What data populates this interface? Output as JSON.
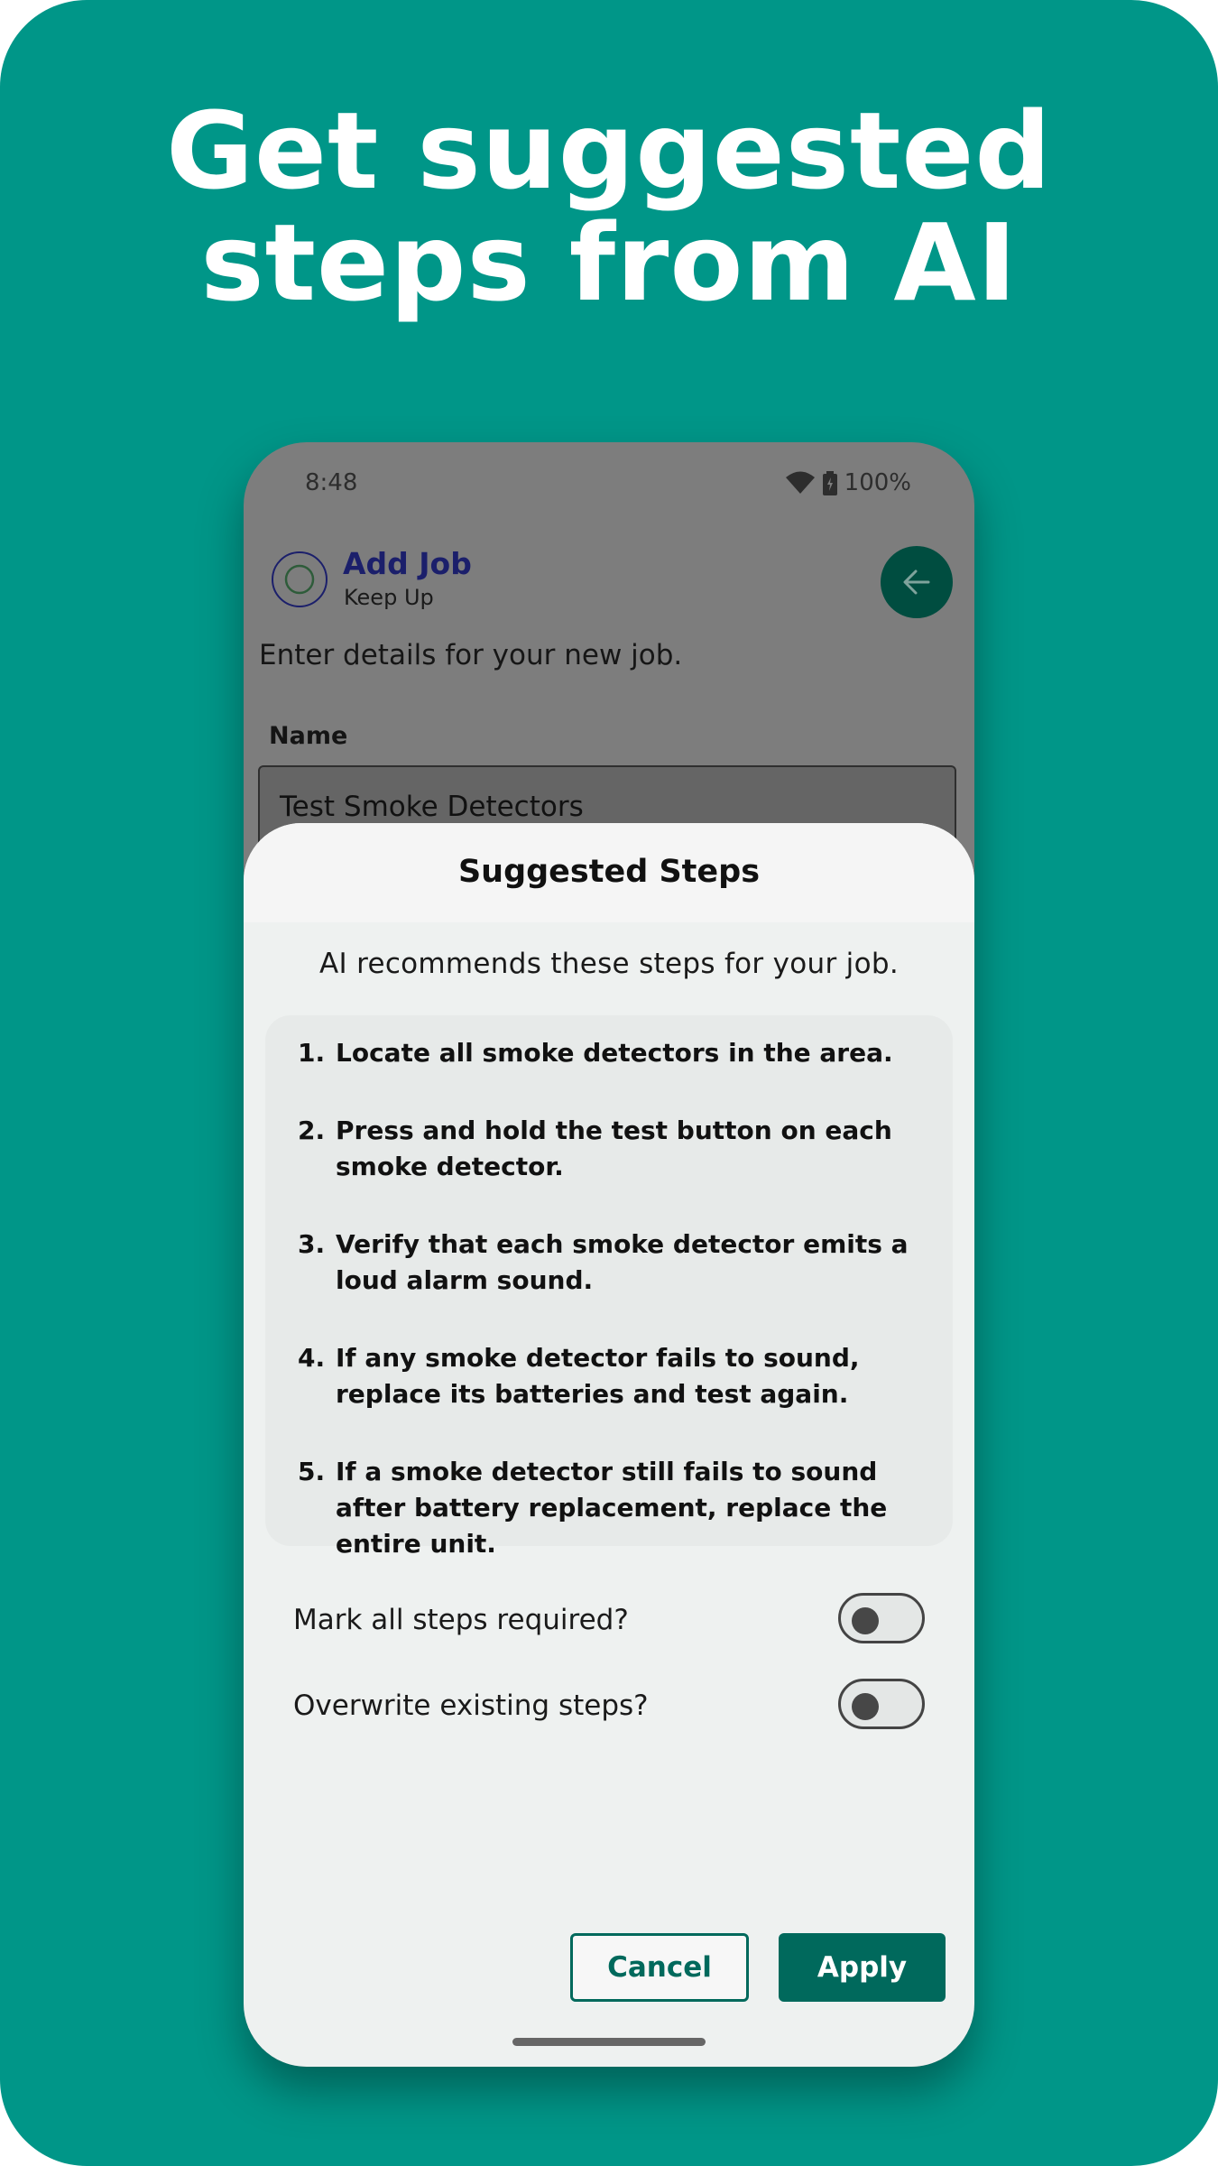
{
  "promo": {
    "headline_line1": "Get suggested",
    "headline_line2": "steps from AI"
  },
  "status_bar": {
    "time": "8:48",
    "battery": "100%"
  },
  "app_bar": {
    "title": "Add Job",
    "subtitle": "Keep Up"
  },
  "form": {
    "intro": "Enter details for your new job.",
    "name_label": "Name",
    "name_value": "Test Smoke Detectors"
  },
  "sheet": {
    "title": "Suggested Steps",
    "subtitle": "AI recommends these steps for your job.",
    "steps": [
      {
        "num": "1.",
        "text": "Locate all smoke detectors in the area."
      },
      {
        "num": "2.",
        "text": "Press and hold the test button on each smoke detector."
      },
      {
        "num": "3.",
        "text": "Verify that each smoke detector emits a loud alarm sound."
      },
      {
        "num": "4.",
        "text": "If any smoke detector fails to sound, replace its batteries and test again."
      },
      {
        "num": "5.",
        "text": "If a smoke detector still fails to sound after battery replacement, replace the entire unit."
      }
    ],
    "toggles": [
      {
        "label": "Mark all steps required?",
        "on": false
      },
      {
        "label": "Overwrite existing steps?",
        "on": false
      }
    ],
    "cancel_label": "Cancel",
    "apply_label": "Apply"
  },
  "colors": {
    "background": "#009688",
    "primary": "#00695c",
    "title_blue": "#1b1f6b"
  },
  "icons": [
    "wifi-icon",
    "battery-icon",
    "app-logo-icon",
    "back-arrow-icon"
  ]
}
